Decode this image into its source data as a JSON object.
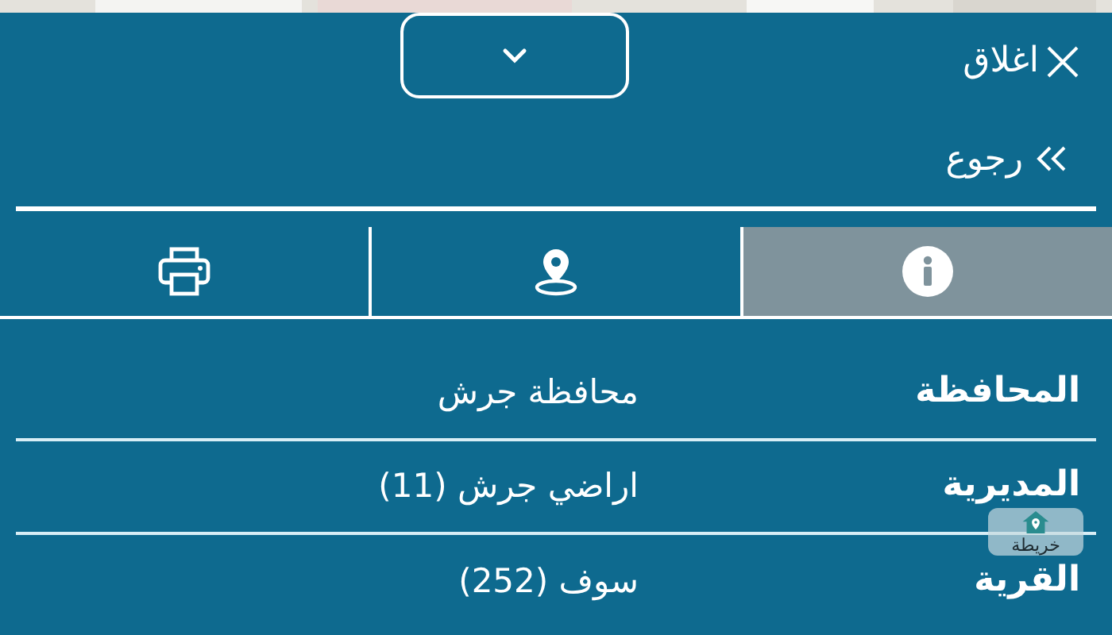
{
  "header": {
    "close_label": "اغلاق",
    "back_label": "رجوع"
  },
  "tabs": [
    {
      "kind": "info",
      "selected": true
    },
    {
      "kind": "location",
      "selected": false
    },
    {
      "kind": "print",
      "selected": false
    }
  ],
  "rows": [
    {
      "label": "المحافظة",
      "value": "محافظة جرش"
    },
    {
      "label": "المديرية",
      "value": "اراضي جرش (11)"
    },
    {
      "label": "القرية",
      "value": "سوف (252)"
    }
  ],
  "map_button": {
    "label": "خريطة"
  }
}
